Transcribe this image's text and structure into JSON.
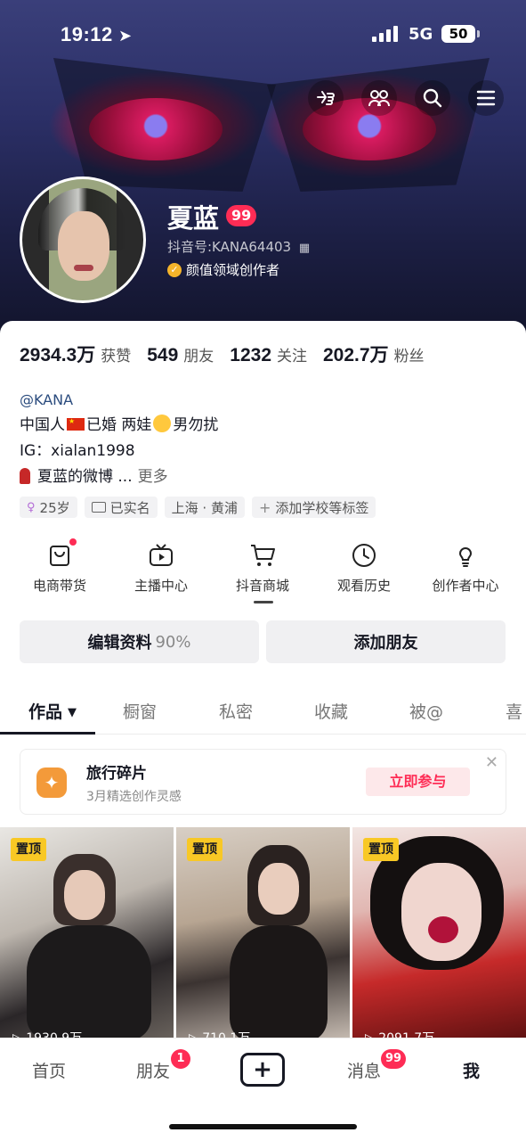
{
  "status_bar": {
    "time": "19:12",
    "network": "5G",
    "battery": "50"
  },
  "header": {
    "icons": [
      "gesture-icon",
      "friends-icon",
      "search-icon",
      "menu-icon"
    ]
  },
  "profile": {
    "name": "夏蓝",
    "level_badge": "99",
    "douyin_id": "抖音号:KANA64403",
    "creator_label": "颜值领域创作者",
    "verified_mark": "✓"
  },
  "stats": [
    {
      "num": "2934.3万",
      "label": "获赞"
    },
    {
      "num": "549",
      "label": "朋友"
    },
    {
      "num": "1232",
      "label": "关注"
    },
    {
      "num": "202.7万",
      "label": "粉丝"
    }
  ],
  "bio": {
    "handle": "@KANA",
    "line2_a": "中国人",
    "line2_b": "已婚 两娃",
    "line2_c": "男勿扰",
    "line3": "IG：xialan1998",
    "line4": "夏蓝的微博 ...",
    "more": "更多"
  },
  "tags": [
    {
      "icon": "female-icon",
      "glyph": "♀",
      "text": "25岁"
    },
    {
      "icon": "id-card-icon",
      "glyph": "",
      "text": "已实名"
    },
    {
      "icon": "",
      "glyph": "",
      "text": "上海 · 黄浦"
    },
    {
      "icon": "add-icon",
      "glyph": "+",
      "text": "添加学校等标签"
    }
  ],
  "quick_actions": [
    {
      "label": "电商带货",
      "icon": "shopping-bag-icon",
      "dot": true
    },
    {
      "label": "主播中心",
      "icon": "tv-icon",
      "dot": false
    },
    {
      "label": "抖音商城",
      "icon": "cart-icon",
      "dot": false
    },
    {
      "label": "观看历史",
      "icon": "clock-icon",
      "dot": false
    },
    {
      "label": "创作者中心",
      "icon": "lightbulb-icon",
      "dot": false
    }
  ],
  "buttons": {
    "edit": "编辑资料",
    "edit_pct": "90%",
    "add_friend": "添加朋友"
  },
  "tabs": [
    "作品",
    "橱窗",
    "私密",
    "收藏",
    "被@",
    "喜"
  ],
  "tab_caret": "▼",
  "banner": {
    "title": "旅行碎片",
    "subtitle": "3月精选创作灵感",
    "action": "立即参与",
    "close": "✕"
  },
  "videos": [
    {
      "pin": "置顶",
      "plays": "1930.9万"
    },
    {
      "pin": "置顶",
      "plays": "710.1万"
    },
    {
      "pin": "置顶",
      "plays": "2091.7万"
    }
  ],
  "nav": {
    "home": "首页",
    "friends": "朋友",
    "friends_badge": "1",
    "plus": "+",
    "messages": "消息",
    "messages_badge": "99",
    "me": "我"
  }
}
